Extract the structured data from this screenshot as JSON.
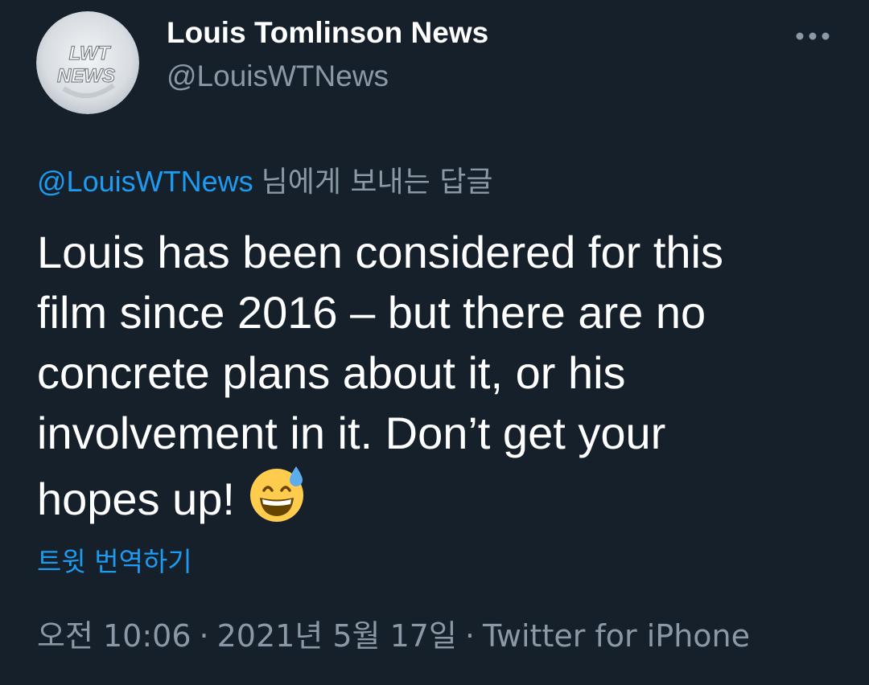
{
  "author": {
    "display_name": "Louis Tomlinson News",
    "handle": "@LouisWTNews",
    "avatar_text_top": "LWT",
    "avatar_text_bottom": "NEWS"
  },
  "header": {
    "more_icon": "more-horizontal-icon"
  },
  "reply": {
    "handle": "@LouisWTNews",
    "suffix": "님에게 보내는 답글"
  },
  "tweet": {
    "lines": [
      "Louis has been considered for this",
      "film since 2016 – but there are no",
      "concrete plans about it, or his",
      "involvement in it. Don’t get your",
      "hopes up!"
    ],
    "emoji": "grinning-face-with-sweat-icon"
  },
  "translate_label": "트윗 번역하기",
  "meta": {
    "time": "오전 10:06",
    "date": "2021년 5월 17일",
    "source": "Twitter for iPhone",
    "separator": "·"
  },
  "colors": {
    "background": "#15202b",
    "text": "#ffffff",
    "secondary": "#8b98a5",
    "accent": "#1d9bf0"
  }
}
